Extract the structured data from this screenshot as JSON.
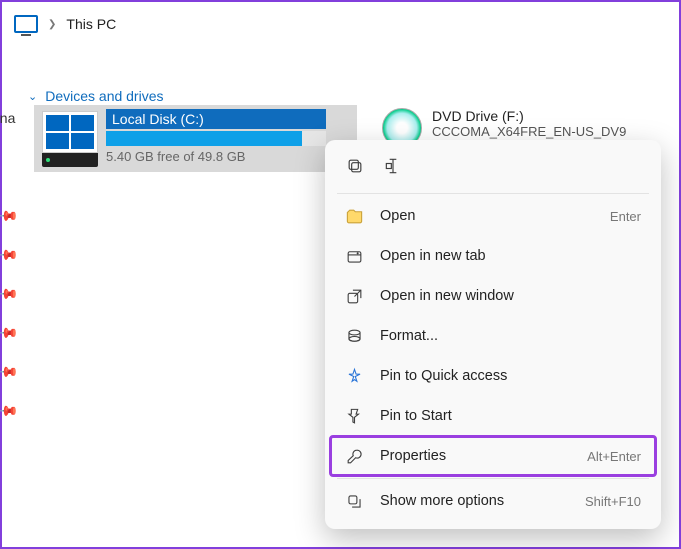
{
  "header": {
    "title": "This PC"
  },
  "leftstrip": {
    "partial_text": "ona"
  },
  "section": {
    "heading": "Devices and drives"
  },
  "drive": {
    "name": "Local Disk (C:)",
    "free_text": "5.40 GB free of 49.8 GB",
    "used_percent": 89
  },
  "dvd": {
    "name": "DVD Drive (F:)",
    "sub": "CCCOMA_X64FRE_EN-US_DV9"
  },
  "menu": {
    "open": "Open",
    "open_hint": "Enter",
    "new_tab": "Open in new tab",
    "new_window": "Open in new window",
    "format": "Format...",
    "pin_qa": "Pin to Quick access",
    "pin_start": "Pin to Start",
    "properties": "Properties",
    "properties_hint": "Alt+Enter",
    "more": "Show more options",
    "more_hint": "Shift+F10"
  }
}
